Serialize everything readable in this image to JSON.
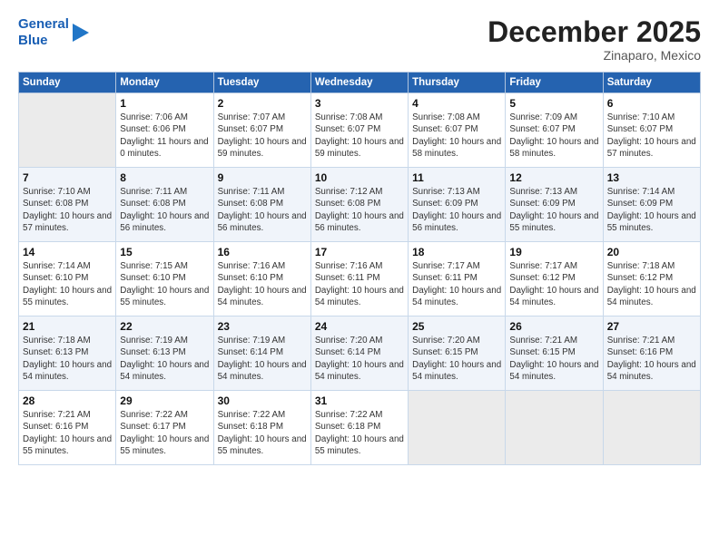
{
  "logo": {
    "line1": "General",
    "line2": "Blue"
  },
  "title": "December 2025",
  "subtitle": "Zinaparo, Mexico",
  "days_header": [
    "Sunday",
    "Monday",
    "Tuesday",
    "Wednesday",
    "Thursday",
    "Friday",
    "Saturday"
  ],
  "weeks": [
    [
      {
        "num": "",
        "empty": true
      },
      {
        "num": "1",
        "rise": "7:06 AM",
        "set": "6:06 PM",
        "daylight": "11 hours and 0 minutes."
      },
      {
        "num": "2",
        "rise": "7:07 AM",
        "set": "6:07 PM",
        "daylight": "10 hours and 59 minutes."
      },
      {
        "num": "3",
        "rise": "7:08 AM",
        "set": "6:07 PM",
        "daylight": "10 hours and 59 minutes."
      },
      {
        "num": "4",
        "rise": "7:08 AM",
        "set": "6:07 PM",
        "daylight": "10 hours and 58 minutes."
      },
      {
        "num": "5",
        "rise": "7:09 AM",
        "set": "6:07 PM",
        "daylight": "10 hours and 58 minutes."
      },
      {
        "num": "6",
        "rise": "7:10 AM",
        "set": "6:07 PM",
        "daylight": "10 hours and 57 minutes."
      }
    ],
    [
      {
        "num": "7",
        "rise": "7:10 AM",
        "set": "6:08 PM",
        "daylight": "10 hours and 57 minutes."
      },
      {
        "num": "8",
        "rise": "7:11 AM",
        "set": "6:08 PM",
        "daylight": "10 hours and 56 minutes."
      },
      {
        "num": "9",
        "rise": "7:11 AM",
        "set": "6:08 PM",
        "daylight": "10 hours and 56 minutes."
      },
      {
        "num": "10",
        "rise": "7:12 AM",
        "set": "6:08 PM",
        "daylight": "10 hours and 56 minutes."
      },
      {
        "num": "11",
        "rise": "7:13 AM",
        "set": "6:09 PM",
        "daylight": "10 hours and 56 minutes."
      },
      {
        "num": "12",
        "rise": "7:13 AM",
        "set": "6:09 PM",
        "daylight": "10 hours and 55 minutes."
      },
      {
        "num": "13",
        "rise": "7:14 AM",
        "set": "6:09 PM",
        "daylight": "10 hours and 55 minutes."
      }
    ],
    [
      {
        "num": "14",
        "rise": "7:14 AM",
        "set": "6:10 PM",
        "daylight": "10 hours and 55 minutes."
      },
      {
        "num": "15",
        "rise": "7:15 AM",
        "set": "6:10 PM",
        "daylight": "10 hours and 55 minutes."
      },
      {
        "num": "16",
        "rise": "7:16 AM",
        "set": "6:10 PM",
        "daylight": "10 hours and 54 minutes."
      },
      {
        "num": "17",
        "rise": "7:16 AM",
        "set": "6:11 PM",
        "daylight": "10 hours and 54 minutes."
      },
      {
        "num": "18",
        "rise": "7:17 AM",
        "set": "6:11 PM",
        "daylight": "10 hours and 54 minutes."
      },
      {
        "num": "19",
        "rise": "7:17 AM",
        "set": "6:12 PM",
        "daylight": "10 hours and 54 minutes."
      },
      {
        "num": "20",
        "rise": "7:18 AM",
        "set": "6:12 PM",
        "daylight": "10 hours and 54 minutes."
      }
    ],
    [
      {
        "num": "21",
        "rise": "7:18 AM",
        "set": "6:13 PM",
        "daylight": "10 hours and 54 minutes."
      },
      {
        "num": "22",
        "rise": "7:19 AM",
        "set": "6:13 PM",
        "daylight": "10 hours and 54 minutes."
      },
      {
        "num": "23",
        "rise": "7:19 AM",
        "set": "6:14 PM",
        "daylight": "10 hours and 54 minutes."
      },
      {
        "num": "24",
        "rise": "7:20 AM",
        "set": "6:14 PM",
        "daylight": "10 hours and 54 minutes."
      },
      {
        "num": "25",
        "rise": "7:20 AM",
        "set": "6:15 PM",
        "daylight": "10 hours and 54 minutes."
      },
      {
        "num": "26",
        "rise": "7:21 AM",
        "set": "6:15 PM",
        "daylight": "10 hours and 54 minutes."
      },
      {
        "num": "27",
        "rise": "7:21 AM",
        "set": "6:16 PM",
        "daylight": "10 hours and 54 minutes."
      }
    ],
    [
      {
        "num": "28",
        "rise": "7:21 AM",
        "set": "6:16 PM",
        "daylight": "10 hours and 55 minutes."
      },
      {
        "num": "29",
        "rise": "7:22 AM",
        "set": "6:17 PM",
        "daylight": "10 hours and 55 minutes."
      },
      {
        "num": "30",
        "rise": "7:22 AM",
        "set": "6:18 PM",
        "daylight": "10 hours and 55 minutes."
      },
      {
        "num": "31",
        "rise": "7:22 AM",
        "set": "6:18 PM",
        "daylight": "10 hours and 55 minutes."
      },
      {
        "num": "",
        "empty": true
      },
      {
        "num": "",
        "empty": true
      },
      {
        "num": "",
        "empty": true
      }
    ]
  ],
  "labels": {
    "sunrise": "Sunrise:",
    "sunset": "Sunset:",
    "daylight": "Daylight:"
  }
}
